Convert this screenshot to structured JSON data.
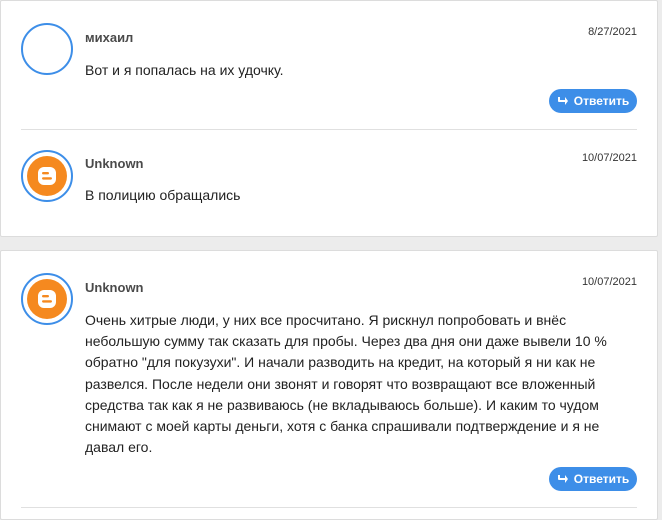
{
  "comments": [
    {
      "author": "михаил",
      "date": "8/27/2021",
      "text": "Вот и я попалась на их удочку.",
      "avatar_icon": "empty-avatar-icon",
      "reply_label": "Ответить"
    },
    {
      "author": "Unknown",
      "date": "10/07/2021",
      "text": "В полицию обращались",
      "avatar_icon": "blogger-icon"
    },
    {
      "author": "Unknown",
      "date": "10/07/2021",
      "text_lines": [
        "Очень хитрые люди, у них все просчитано. Я рискнул попробовать и внёс",
        "небольшую сумму так сказать для пробы. Через два дня они даже вывели 10 %",
        "обратно \"для покузухи\". И начали разводить на кредит, на который я ни как не",
        "развелся. После недели они звонят и говорят что возвращают все вложенный",
        "средства так как я не развиваюсь (не вкладываюсь больше). И каким то чудом",
        "снимают с моей карты деньги, хотя с банка спрашивали подтверждение и я не",
        "давал его."
      ],
      "avatar_icon": "blogger-icon",
      "reply_label": "Ответить"
    }
  ],
  "colors": {
    "accent": "#3d8ee8",
    "blogger_orange": "#f5891f"
  }
}
